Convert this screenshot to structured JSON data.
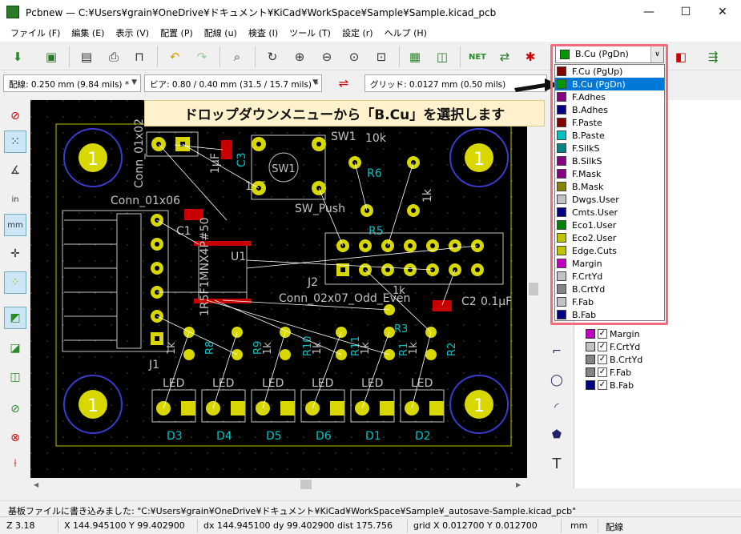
{
  "window": {
    "title": "Pcbnew — C:¥Users¥grain¥OneDrive¥ドキュメント¥KiCad¥WorkSpace¥Sample¥Sample.kicad_pcb",
    "minimize": "—",
    "maximize": "☐",
    "close": "✕"
  },
  "menu": [
    "ファイル (F)",
    "編集 (E)",
    "表示 (V)",
    "配置 (P)",
    "配線 (u)",
    "検査 (I)",
    "ツール (T)",
    "設定 (r)",
    "ヘルプ (H)"
  ],
  "toolbar2": {
    "track": "配線: 0.250 mm (9.84 mils) *",
    "via": "ビア: 0.80 / 0.40 mm (31.5 / 15.7 mils) *",
    "grid": "グリッド: 0.0127 mm (0.50 mils)"
  },
  "callout": "ドロップダウンメニューから「B.Cu」を選択します",
  "layer_select": {
    "value": "B.Cu (PgDn)",
    "color": "#009900"
  },
  "layers": [
    {
      "name": "F.Cu (PgUp)",
      "color": "#840000"
    },
    {
      "name": "B.Cu (PgDn)",
      "color": "#009900",
      "selected": true
    },
    {
      "name": "F.Adhes",
      "color": "#840084"
    },
    {
      "name": "B.Adhes",
      "color": "#000084"
    },
    {
      "name": "F.Paste",
      "color": "#840000"
    },
    {
      "name": "B.Paste",
      "color": "#00c2c2"
    },
    {
      "name": "F.SilkS",
      "color": "#008484"
    },
    {
      "name": "B.SilkS",
      "color": "#840084"
    },
    {
      "name": "F.Mask",
      "color": "#840084"
    },
    {
      "name": "B.Mask",
      "color": "#848400"
    },
    {
      "name": "Dwgs.User",
      "color": "#c2c2c2"
    },
    {
      "name": "Cmts.User",
      "color": "#000084"
    },
    {
      "name": "Eco1.User",
      "color": "#008400"
    },
    {
      "name": "Eco2.User",
      "color": "#c2c200"
    },
    {
      "name": "Edge.Cuts",
      "color": "#c2c200"
    },
    {
      "name": "Margin",
      "color": "#c200c2"
    },
    {
      "name": "F.CrtYd",
      "color": "#c2c2c2"
    },
    {
      "name": "B.CrtYd",
      "color": "#848484"
    },
    {
      "name": "F.Fab",
      "color": "#c2c2c2"
    },
    {
      "name": "B.Fab",
      "color": "#000084"
    }
  ],
  "panel": [
    {
      "name": "Margin",
      "color": "#c200c2"
    },
    {
      "name": "F.CrtYd",
      "color": "#c2c2c2"
    },
    {
      "name": "B.CrtYd",
      "color": "#848484"
    },
    {
      "name": "F.Fab",
      "color": "#848484"
    },
    {
      "name": "B.Fab",
      "color": "#000084"
    }
  ],
  "status_message": "基板ファイルに書き込みました: \"C:¥Users¥grain¥OneDrive¥ドキュメント¥KiCad¥WorkSpace¥Sample¥_autosave-Sample.kicad_pcb\"",
  "status": {
    "zoom": "Z 3.18",
    "xy": "X 144.945100  Y 99.402900",
    "dxy": "dx 144.945100  dy 99.402900  dist 175.756",
    "grid": "grid X 0.012700  Y 0.012700",
    "unit": "mm",
    "mode": "配線"
  },
  "pcb": {
    "holes": [
      "1",
      "1",
      "1",
      "1"
    ],
    "refs": [
      "Conn_01x02",
      "Conn_01x06",
      "J1",
      "C1",
      "C3",
      "1μF",
      "1μF",
      "SW1",
      "SW_Push",
      "10k",
      "R6",
      "R5",
      "1k",
      "J2",
      "Conn_02x07_Odd_Even",
      "R3",
      "1k",
      "C2",
      "0.1μF",
      "R8",
      "R9",
      "R10",
      "R11",
      "R1",
      "R2",
      "1k",
      "1k",
      "1k",
      "1k",
      "1k",
      "LED",
      "LED",
      "LED",
      "LED",
      "LED",
      "LED",
      "D3",
      "D4",
      "D5",
      "D6",
      "D1",
      "D2",
      "U1",
      "1R5F1MNX4P#50",
      "SW1"
    ]
  }
}
